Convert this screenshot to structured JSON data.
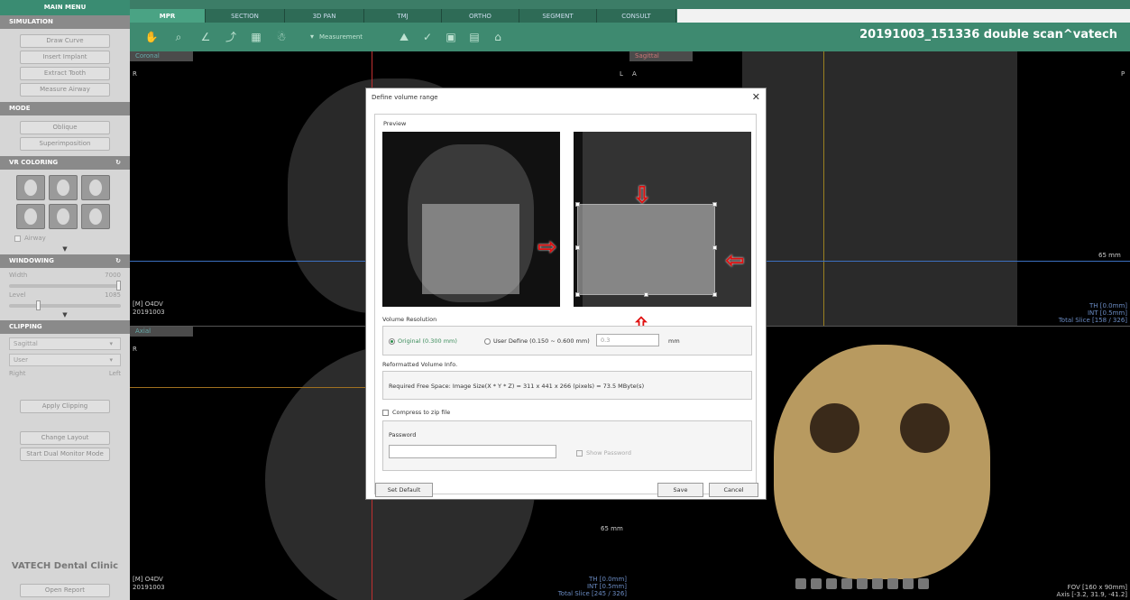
{
  "left_panel": {
    "main_menu": "MAIN MENU",
    "simulation": {
      "header": "SIMULATION",
      "buttons": [
        "Draw Curve",
        "Insert Implant",
        "Extract Tooth",
        "Measure Airway"
      ]
    },
    "mode": {
      "header": "MODE",
      "buttons": [
        "Oblique",
        "Superimposition"
      ]
    },
    "vr_coloring": {
      "header": "VR COLORING",
      "airway_label": "Airway"
    },
    "windowing": {
      "header": "WINDOWING",
      "width_label": "Width",
      "width_value": "7000",
      "level_label": "Level",
      "level_value": "1085"
    },
    "clipping": {
      "header": "CLIPPING",
      "plane": "Sagittal",
      "mode": "User",
      "right_label": "Right",
      "left_label": "Left",
      "apply": "Apply Clipping"
    },
    "change_layout": "Change Layout",
    "dual_monitor": "Start Dual Monitor Mode",
    "clinic": "VATECH Dental Clinic",
    "open_report": "Open Report"
  },
  "tabs": [
    "MPR",
    "SECTION",
    "3D PAN",
    "TMJ",
    "ORTHO",
    "SEGMENT",
    "CONSULT"
  ],
  "active_tab": "MPR",
  "toolbar": {
    "measurement": "Measurement"
  },
  "patient": "20191003_151336 double scan^vatech",
  "viewports": {
    "coronal": {
      "label": "Coronal",
      "r": "R",
      "l": "L",
      "info1": "[M] O4DV",
      "info2": "20191003"
    },
    "sagittal": {
      "label": "Sagittal",
      "a": "A",
      "p": "P",
      "dist": "65 mm",
      "th": "TH [0.0mm]",
      "int": "INT [0.5mm]",
      "total": "Total Slice [158 / 326]"
    },
    "axial": {
      "label": "Axial",
      "r": "R",
      "dist": "65 mm",
      "info1": "[M] O4DV",
      "info2": "20191003",
      "th": "TH [0.0mm]",
      "int": "INT [0.5mm]",
      "total": "Total Slice [245 / 326]"
    },
    "vr": {
      "fov": "FOV [160 x 90mm]",
      "axis": "Axis [-3.2, 31.9, -41.2]"
    }
  },
  "dialog": {
    "title": "Define volume range",
    "preview": "Preview",
    "volume_resolution": "Volume Resolution",
    "original": "Original (0.300 mm)",
    "user_define": "User Define (0.150 ~ 0.600 mm)",
    "user_value": "0.3",
    "unit": "mm",
    "reformatted": "Reformatted Volume Info.",
    "required_space": "Required Free Space: Image Size(X * Y * Z) = 311 x 441 x 266 (pixels) = 73.5 MByte(s)",
    "compress": "Compress to zip file",
    "password": "Password",
    "show_password": "Show Password",
    "set_default": "Set Default",
    "save": "Save",
    "cancel": "Cancel"
  },
  "colors": {
    "accent": "#3e8a70",
    "arrow": "#e01010"
  }
}
